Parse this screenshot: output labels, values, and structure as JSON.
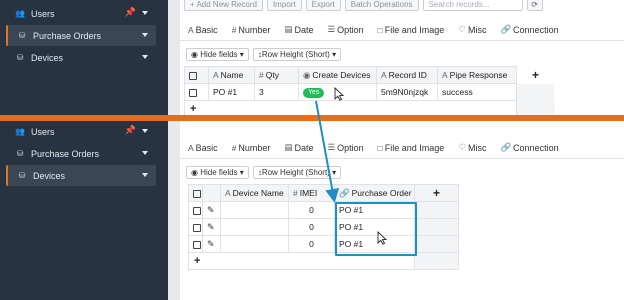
{
  "top_view": {
    "sidebar": {
      "items": [
        {
          "label": "Users",
          "icon": "users-icon"
        },
        {
          "label": "Purchase Orders",
          "icon": "database-icon",
          "active": true
        },
        {
          "label": "Devices",
          "icon": "database-icon"
        }
      ]
    },
    "toolbar": {
      "buttons": [
        "+ Add New Record",
        "Import",
        "Export",
        "Batch Operations"
      ],
      "search_placeholder": "Search records..."
    },
    "tabs": [
      "Basic",
      "Number",
      "Date",
      "Option",
      "File and Image",
      "Misc",
      "Connection"
    ],
    "fields_bar": {
      "hide_fields": "Hide fields",
      "row_height": "Row Height (Short)"
    },
    "table": {
      "columns": [
        "Name",
        "Qty",
        "Create Devices",
        "Record ID",
        "Pipe Response"
      ],
      "rows": [
        {
          "name": "PO #1",
          "qty": "3",
          "create_devices": "Yes",
          "record_id": "5m9N0njzqk",
          "pipe_response": "success"
        }
      ]
    }
  },
  "bottom_view": {
    "sidebar": {
      "items": [
        {
          "label": "Users",
          "icon": "users-icon"
        },
        {
          "label": "Purchase Orders",
          "icon": "database-icon"
        },
        {
          "label": "Devices",
          "icon": "database-icon",
          "active": true
        }
      ]
    },
    "tabs": [
      "Basic",
      "Number",
      "Date",
      "Option",
      "File and Image",
      "Misc",
      "Connection"
    ],
    "fields_bar": {
      "hide_fields": "Hide fields",
      "row_height": "Row Height (Short)"
    },
    "table": {
      "columns": [
        "Device Name",
        "IMEI",
        "Purchase Order"
      ],
      "rows": [
        {
          "device_name": "",
          "imei": "0",
          "purchase_order": "PO #1"
        },
        {
          "device_name": "",
          "imei": "0",
          "purchase_order": "PO #1"
        },
        {
          "device_name": "",
          "imei": "0",
          "purchase_order": "PO #1"
        }
      ]
    }
  },
  "colors": {
    "sidebar_bg": "#283341",
    "divider": "#ee6b10",
    "highlight": "#1e8fc6",
    "yes_badge": "#22bb55"
  }
}
